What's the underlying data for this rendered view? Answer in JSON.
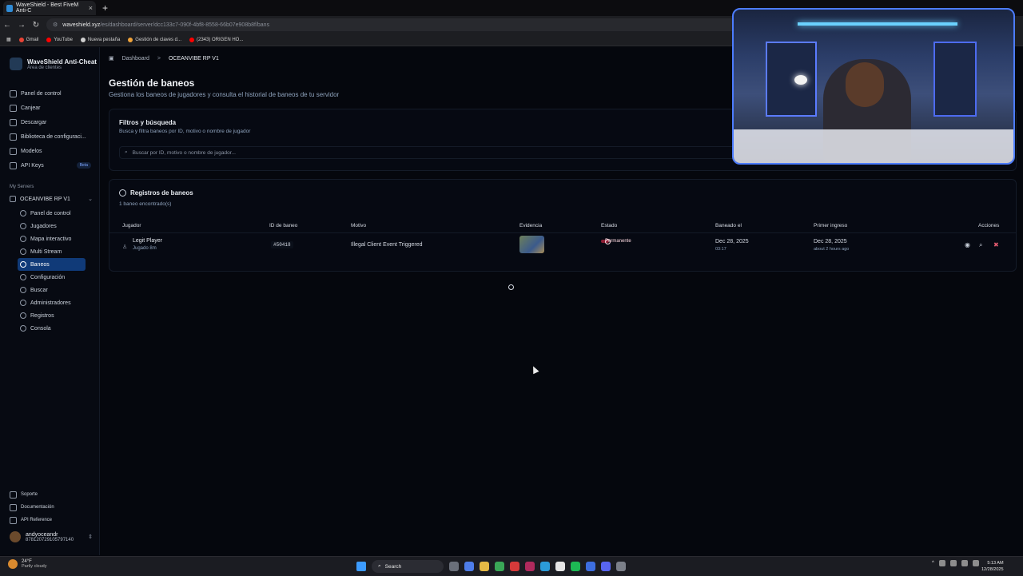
{
  "browser": {
    "tab_title": "WaveShield - Best FiveM Anti-C",
    "url_host": "waveshield.xyz",
    "url_path": "/es/dashboard/server/dcc133c7-090f-4bf8-8558-66b07e908b8f/bans",
    "bookmarks": [
      "Gmail",
      "YouTube",
      "Nueva pestaña",
      "Gestión de claves d...",
      "(2343) ORIGEN HO..."
    ]
  },
  "sidebar": {
    "brand_title": "WaveShield Anti-Cheat",
    "brand_sub": "Área de clientes",
    "main_items": [
      "Panel de control",
      "Canjear",
      "Descargar",
      "Biblioteca de configuraci...",
      "Modelos",
      "API Keys"
    ],
    "beta_label": "Beta",
    "section_label": "My Servers",
    "server_name": "OCEANVIBE RP V1",
    "server_items": [
      "Panel de control",
      "Jugadores",
      "Mapa interactivo",
      "Multi Stream",
      "Baneos",
      "Configuración",
      "Buscar",
      "Administradores",
      "Registros",
      "Consola"
    ],
    "bottom_items": [
      "Soporte",
      "Documentación",
      "API Reference"
    ],
    "user_name": "andyoceandr",
    "user_id": "878120729105797140"
  },
  "header": {
    "crumb_1": "Dashboard",
    "crumb_sep": ">",
    "crumb_2": "OCEANVIBE RP V1",
    "title": "Gestión de baneos",
    "subtitle": "Gestiona los baneos de jugadores y consulta el historial de baneos de tu servidor"
  },
  "filters": {
    "title": "Filtros y búsqueda",
    "subtitle": "Busca y filtra baneos por ID, motivo o nombre de jugador",
    "search_placeholder": "Buscar por ID, motivo o nombre de jugador..."
  },
  "bans": {
    "title": "Registros de baneos",
    "count_text": "1 baneo encontrado(s)",
    "columns": [
      "Jugador",
      "ID de baneo",
      "Motivo",
      "Evidencia",
      "Estado",
      "Baneado el",
      "Primer ingreso",
      "Acciones"
    ],
    "rows": [
      {
        "player": "Legit Player",
        "played": "Jugado 8m",
        "ban_id": "#50418",
        "reason": "Illegal Client Event Triggered",
        "status": "Permanente",
        "banned_date": "Dec 28, 2025",
        "banned_time": "03:17",
        "first_join": "Dec 28, 2025",
        "first_join_ago": "about 2 hours ago"
      }
    ]
  },
  "taskbar": {
    "temp": "24°F",
    "condition": "Partly cloudy",
    "search_label": "Search",
    "time": "5:13 AM",
    "date": "12/28/2025"
  },
  "colors": {
    "accent": "#103a78",
    "danger": "#8a1d33",
    "background": "#05070d"
  }
}
